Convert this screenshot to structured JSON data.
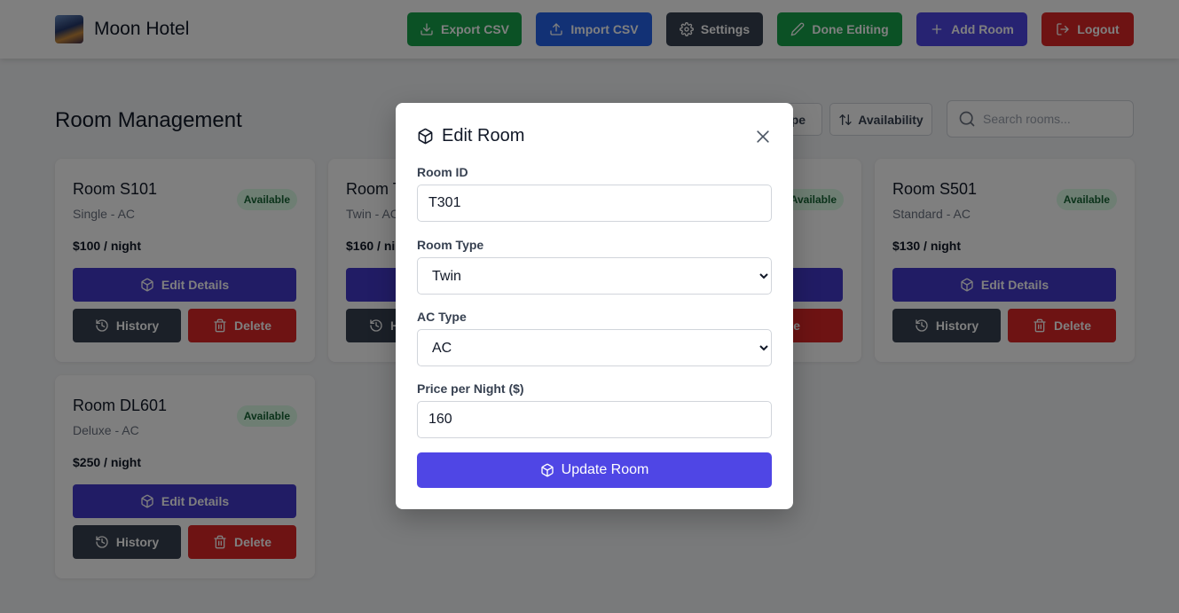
{
  "header": {
    "brand": "Moon Hotel",
    "buttons": {
      "export": "Export CSV",
      "import": "Import CSV",
      "settings": "Settings",
      "done_editing": "Done Editing",
      "add_room": "Add Room",
      "logout": "Logout"
    }
  },
  "main": {
    "title": "Room Management",
    "sort_buttons": {
      "type": "ype",
      "availability": "Availability"
    },
    "search_placeholder": "Search rooms..."
  },
  "rooms": [
    {
      "title": "Room S101",
      "subtitle": "Single - AC",
      "price": "$100 / night",
      "status": "Available"
    },
    {
      "title": "Room T",
      "subtitle": "Twin - AC",
      "price": "$160 / ni",
      "status": "Available"
    },
    {
      "title": "",
      "subtitle": "",
      "price": "",
      "status": "Available"
    },
    {
      "title": "Room S501",
      "subtitle": "Standard - AC",
      "price": "$130 / night",
      "status": "Available"
    },
    {
      "title": "Room DL601",
      "subtitle": "Deluxe - AC",
      "price": "$250 / night",
      "status": "Available"
    }
  ],
  "card_buttons": {
    "edit": "Edit Details",
    "history": "History",
    "delete": "Delete",
    "history_clipped": "H",
    "delete_clipped": "elete"
  },
  "modal": {
    "title": "Edit Room",
    "room_id": {
      "label": "Room ID",
      "value": "T301"
    },
    "room_type": {
      "label": "Room Type",
      "value": "Twin"
    },
    "ac_type": {
      "label": "AC Type",
      "value": "AC"
    },
    "price": {
      "label": "Price per Night ($)",
      "value": "160"
    },
    "submit": "Update Room"
  },
  "colors": {
    "green": "#16a34a",
    "blue": "#2563eb",
    "dark": "#374151",
    "indigo": "#4f46e5",
    "red": "#dc2626",
    "badge_bg": "#dcfce7",
    "badge_fg": "#166534"
  }
}
